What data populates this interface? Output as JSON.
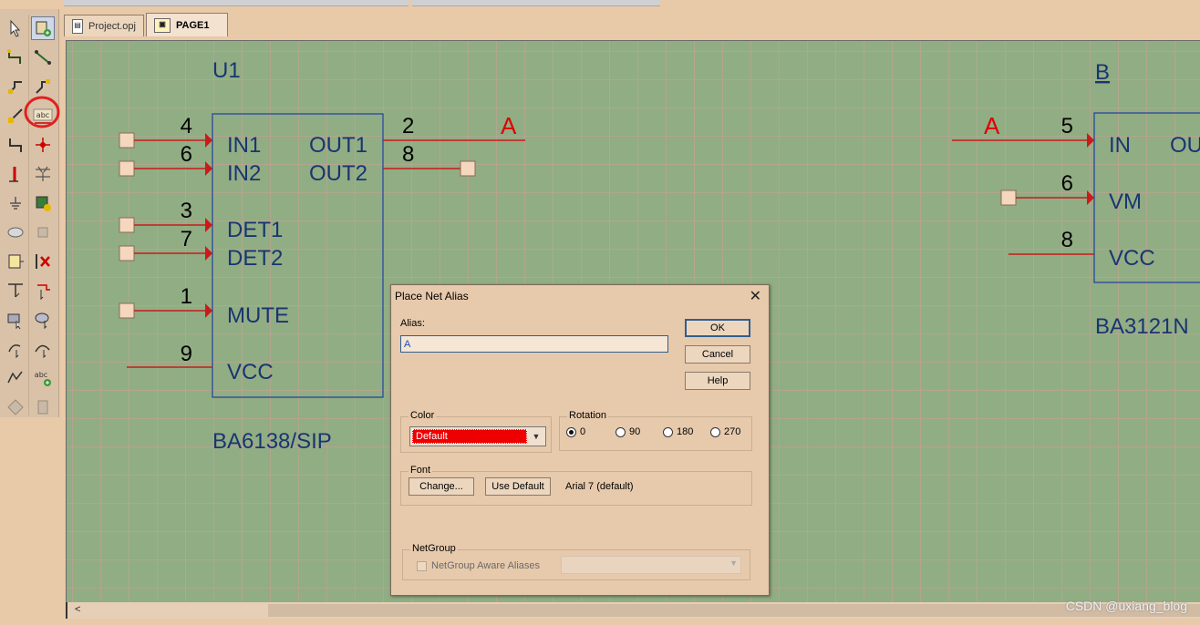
{
  "tabs": [
    {
      "label": "Project.opj",
      "icon": "project-icon",
      "active": false
    },
    {
      "label": "PAGE1",
      "icon": "schematic-page-icon",
      "active": true
    }
  ],
  "schematic": {
    "u1": {
      "refdes": "U1",
      "part": "BA6138/SIP",
      "left_pins": [
        {
          "num": "4",
          "name": "IN1"
        },
        {
          "num": "6",
          "name": "IN2"
        },
        {
          "num": "3",
          "name": "DET1"
        },
        {
          "num": "7",
          "name": "DET2"
        },
        {
          "num": "1",
          "name": "MUTE"
        },
        {
          "num": "9",
          "name": "VCC"
        }
      ],
      "right_pins": [
        {
          "num": "2",
          "name": "OUT1"
        },
        {
          "num": "8",
          "name": "OUT2"
        }
      ],
      "net_alias": "A"
    },
    "u2": {
      "refdes": "B",
      "part": "BA3121N",
      "left_pins": [
        {
          "num": "5",
          "name": "IN"
        },
        {
          "num": "6",
          "name": "VM"
        },
        {
          "num": "8",
          "name": "VCC"
        }
      ],
      "right_pin_name": "OU",
      "net_alias": "A"
    }
  },
  "dialog": {
    "title": "Place Net Alias",
    "alias_label": "Alias:",
    "alias_value": "A",
    "ok": "OK",
    "cancel": "Cancel",
    "help": "Help",
    "color_label": "Color",
    "color_value": "Default",
    "color_hex": "#ee0000",
    "rotation_label": "Rotation",
    "rotations": [
      "0",
      "90",
      "180",
      "270"
    ],
    "rotation_selected": "0",
    "font_label": "Font",
    "change": "Change...",
    "use_default": "Use Default",
    "font_value": "Arial 7 (default)",
    "netgroup_label": "NetGroup",
    "netgroup_checkbox": "NetGroup Aware Aliases"
  },
  "watermark": "CSDN @uxiang_blog",
  "colors": {
    "canvas": "#91ad84",
    "wire": "#cc1a1a",
    "part_outline": "#1f3fa0",
    "part_text": "#1a3570",
    "alias_text": "#e00000",
    "highlight_ring": "#e02020"
  }
}
